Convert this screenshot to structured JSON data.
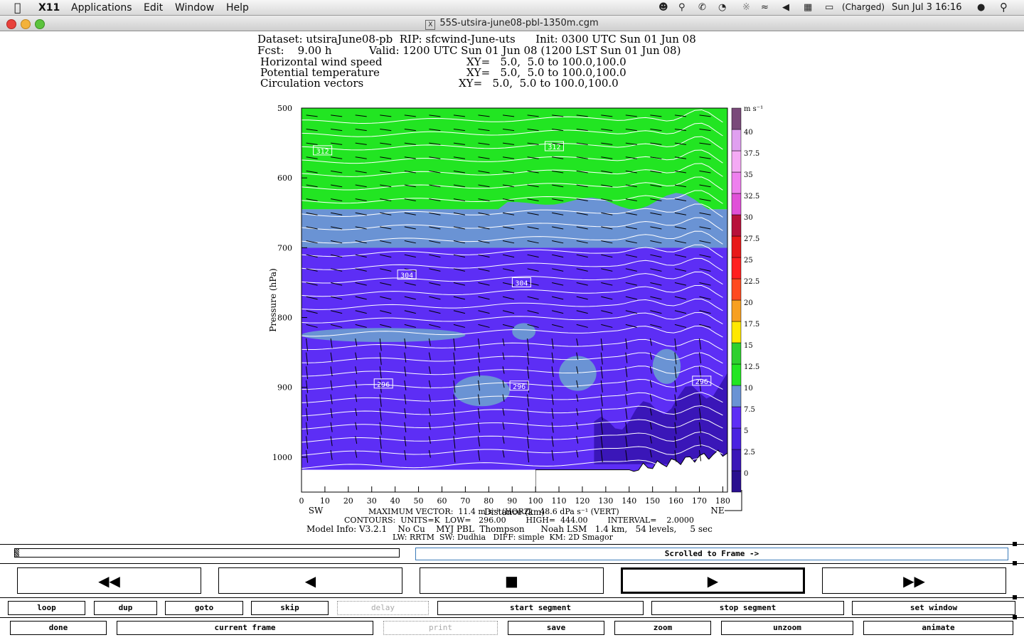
{
  "menubar": {
    "items": [
      "X11",
      "Applications",
      "Edit",
      "Window",
      "Help"
    ],
    "battery": "(Charged)",
    "clock": "Sun Jul 3  16:16"
  },
  "window": {
    "title": "55S-utsira-june08-pbl-1350m.cgm"
  },
  "plot_header": {
    "line1": "Dataset: utsiraJune08-pb  RIP: sfcwind-June-uts      Init: 0300 UTC Sun 01 Jun 08",
    "line2": "Fcst:    9.00 h           Valid: 1200 UTC Sun 01 Jun 08 (1200 LST Sun 01 Jun 08)",
    "field1": "Horizontal wind speed",
    "field1_xy": "XY=   5.0,  5.0 to 100.0,100.0",
    "field2": "Potential temperature",
    "field2_xy": "XY=   5.0,  5.0 to 100.0,100.0",
    "field3": "Circulation vectors",
    "field3_xy": "XY=   5.0,  5.0 to 100.0,100.0"
  },
  "plot_footer": {
    "maxvec": "MAXIMUM VECTOR:  11.4 m s⁻¹ (HORZ)   48.6 dPa s⁻¹ (VERT)",
    "contours": "CONTOURS:  UNITS=K  LOW=   296.00        HIGH=  444.00        INTERVAL=    2.0000",
    "model": "Model Info: V3.2.1    No Cu    MYJ PBL  Thompson      Noah LSM   1.4 km,   54 levels,     5 sec",
    "model2": "LW: RRTM  SW: Dudhia   DIFF: simple  KM: 2D Smagor"
  },
  "chart_data": {
    "type": "heatmap",
    "ylabel": "Pressure (hPa)",
    "xlabel": "Distance (km)",
    "y_ticks": [
      500,
      600,
      700,
      800,
      900,
      1000
    ],
    "x_ticks": [
      0,
      10,
      20,
      30,
      40,
      50,
      60,
      70,
      80,
      90,
      100,
      110,
      120,
      130,
      140,
      150,
      160,
      170,
      180
    ],
    "ylim": [
      1050,
      500
    ],
    "xlim": [
      0,
      182
    ],
    "x_left_label": "SW",
    "x_right_label": "NE",
    "contour_labels": [
      {
        "x": 9,
        "p": 561,
        "label": "312"
      },
      {
        "x": 108,
        "p": 555,
        "label": "312"
      },
      {
        "x": 45,
        "p": 739,
        "label": "304"
      },
      {
        "x": 94,
        "p": 750,
        "label": "304"
      },
      {
        "x": 35,
        "p": 895,
        "label": "296"
      },
      {
        "x": 93,
        "p": 898,
        "label": "296"
      },
      {
        "x": 171,
        "p": 891,
        "label": "296"
      }
    ],
    "colorbar": {
      "unit": "m s⁻¹",
      "levels": [
        "0",
        "2.5",
        "5",
        "7.5",
        "10",
        "12.5",
        "15",
        "17.5",
        "20",
        "22.5",
        "25",
        "27.5",
        "30",
        "32.5",
        "35",
        "37.5",
        "40"
      ],
      "colors": [
        "#2a0f8f",
        "#3a16b8",
        "#4a22e0",
        "#5d2ef5",
        "#6a93d4",
        "#22e522",
        "#2fd02f",
        "#ffe800",
        "#f7a020",
        "#ff4a20",
        "#ff2020",
        "#e81818",
        "#b8103a",
        "#e050d8",
        "#ee80ee",
        "#f4aaf4",
        "#e0a0f0",
        "#7a4a7a"
      ]
    },
    "bands": [
      {
        "name": "",
        "p_top": 500,
        "p_bottom": 645,
        "color": "#22e522"
      },
      {
        "name": "",
        "p_top": 645,
        "p_bottom": 700,
        "color": "#6a93d4"
      },
      {
        "name": "",
        "p_top": 700,
        "p_bottom": 1050,
        "color": "#5d2ef5"
      }
    ]
  },
  "controls": {
    "progress_label": "Scrolled to Frame ->",
    "big_buttons": [
      "◀◀",
      "◀",
      "■",
      "▶",
      "▶▶"
    ],
    "row1": [
      "loop",
      "dup",
      "goto",
      "skip",
      "delay",
      "start segment",
      "stop segment",
      "set window"
    ],
    "row2": [
      "done",
      "current frame",
      "print",
      "save",
      "zoom",
      "unzoom",
      "animate"
    ]
  }
}
